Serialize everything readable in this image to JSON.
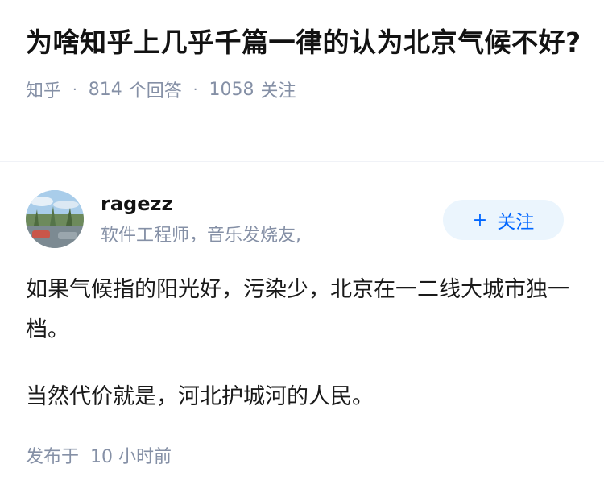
{
  "question": {
    "title": "为啥知乎上几乎千篇一律的认为北京气候不好?",
    "site": "知乎",
    "answer_count": "814",
    "answer_label": "个回答",
    "follower_count": "1058",
    "follower_label": "关注"
  },
  "author": {
    "name": "ragezz",
    "bio": "软件工程师，音乐发烧友,",
    "follow_label": "关注",
    "follow_icon": "plus-icon"
  },
  "answer": {
    "paragraphs": [
      "如果气候指的阳光好，污染少，北京在一二线大城市独一档。",
      "当然代价就是，河北护城河的人民。"
    ],
    "time_label": "发布于",
    "time_value": "10 小时前"
  },
  "colors": {
    "meta": "#8590a6",
    "accent": "#0066ff",
    "follow_bg": "#ebf5fd"
  }
}
